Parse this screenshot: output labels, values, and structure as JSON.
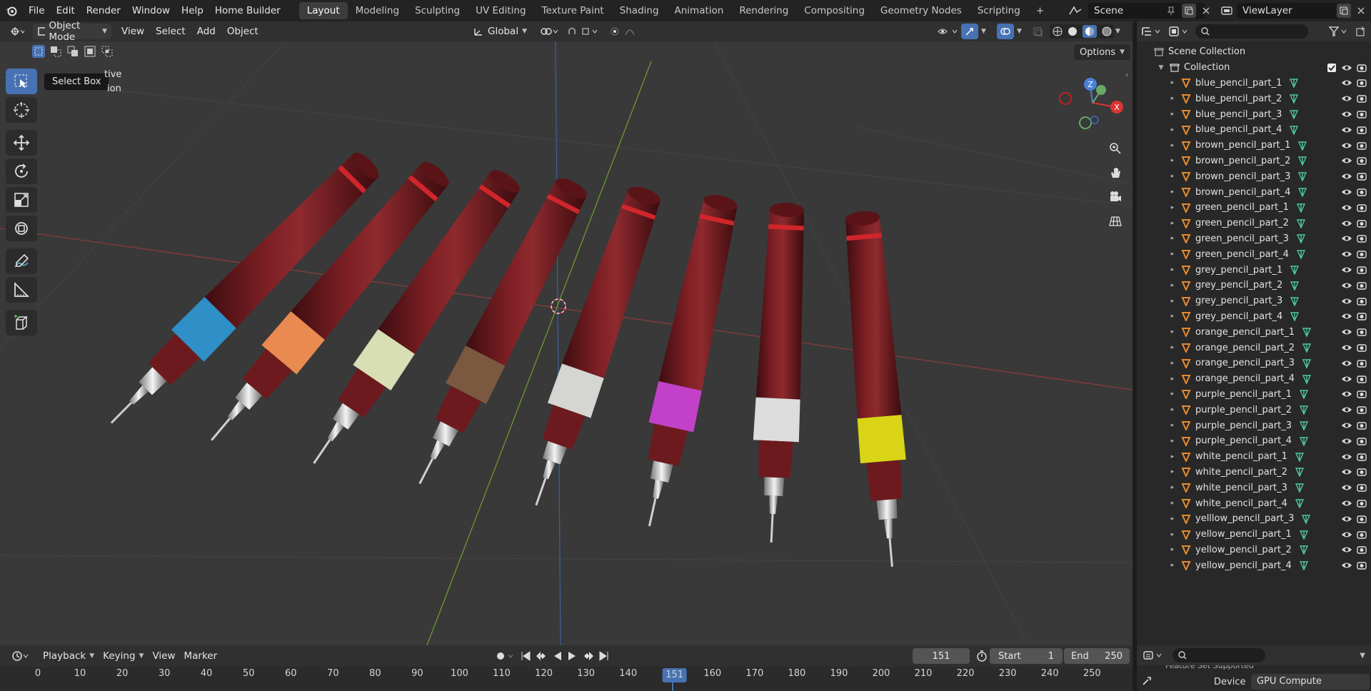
{
  "menu": {
    "file": "File",
    "edit": "Edit",
    "render": "Render",
    "window": "Window",
    "help": "Help",
    "home_builder": "Home Builder"
  },
  "workspaces": [
    "Layout",
    "Modeling",
    "Sculpting",
    "UV Editing",
    "Texture Paint",
    "Shading",
    "Animation",
    "Rendering",
    "Compositing",
    "Geometry Nodes",
    "Scripting"
  ],
  "active_workspace": "Layout",
  "scene": {
    "name": "Scene",
    "view_layer": "ViewLayer"
  },
  "viewport_header": {
    "mode": "Object Mode",
    "view": "View",
    "select": "Select",
    "add": "Add",
    "object": "Object",
    "orientation": "Global",
    "options": "Options"
  },
  "tooltip": {
    "text": "Select Box"
  },
  "partial_labels": {
    "line1": "tive",
    "line2": "ion"
  },
  "gizmo": {
    "z": "Z",
    "x": "X"
  },
  "outliner": {
    "scene_collection": "Scene Collection",
    "collection": "Collection",
    "items": [
      "blue_pencil_part_1",
      "blue_pencil_part_2",
      "blue_pencil_part_3",
      "blue_pencil_part_4",
      "brown_pencil_part_1",
      "brown_pencil_part_2",
      "brown_pencil_part_3",
      "brown_pencil_part_4",
      "green_pencil_part_1",
      "green_pencil_part_2",
      "green_pencil_part_3",
      "green_pencil_part_4",
      "grey_pencil_part_1",
      "grey_pencil_part_2",
      "grey_pencil_part_3",
      "grey_pencil_part_4",
      "orange_pencil_part_1",
      "orange_pencil_part_2",
      "orange_pencil_part_3",
      "orange_pencil_part_4",
      "purple_pencil_part_1",
      "purple_pencil_part_2",
      "purple_pencil_part_3",
      "purple_pencil_part_4",
      "white_pencil_part_1",
      "white_pencil_part_2",
      "white_pencil_part_3",
      "white_pencil_part_4",
      "yelllow_pencil_part_3",
      "yellow_pencil_part_1",
      "yellow_pencil_part_2",
      "yellow_pencil_part_4"
    ]
  },
  "timeline": {
    "playback": "Playback",
    "keying": "Keying",
    "view": "View",
    "marker": "Marker",
    "current_frame": "151",
    "start_label": "Start",
    "start": "1",
    "end_label": "End",
    "end": "250",
    "ticks": [
      "0",
      "10",
      "20",
      "30",
      "40",
      "50",
      "60",
      "70",
      "80",
      "90",
      "100",
      "110",
      "120",
      "130",
      "140",
      "151",
      "160",
      "170",
      "180",
      "190",
      "200",
      "210",
      "220",
      "230",
      "240",
      "250"
    ]
  },
  "properties": {
    "device_label": "Device",
    "device_value": "GPU Compute",
    "cut_text": "Feature Set     Supported"
  },
  "pencil_band_colors": [
    "#2f8fc7",
    "#e98a50",
    "#d9dfb4",
    "#7a5940",
    "#d5d5d2",
    "#c241c9",
    "#dcdcdc",
    "#d9d416"
  ],
  "colors": {
    "accent": "#4772b3",
    "object_orange": "#e88a2e",
    "mesh_green": "#4fc7a4"
  }
}
